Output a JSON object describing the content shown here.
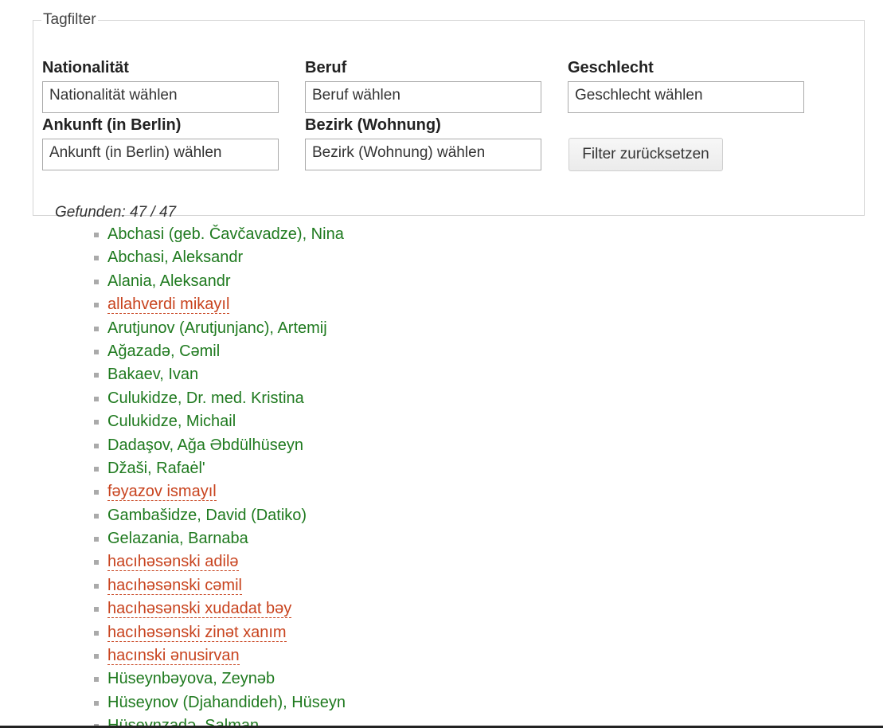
{
  "filter": {
    "legend": "Tagfilter",
    "fields": [
      {
        "label": "Nationalität",
        "placeholder": "Nationalität wählen"
      },
      {
        "label": "Beruf",
        "placeholder": "Beruf wählen"
      },
      {
        "label": "Geschlecht",
        "placeholder": "Geschlecht wählen"
      },
      {
        "label": "Ankunft (in Berlin)",
        "placeholder": "Ankunft (in Berlin) wählen"
      },
      {
        "label": "Bezirk (Wohnung)",
        "placeholder": "Bezirk (Wohnung) wählen"
      }
    ],
    "reset_label": "Filter zurücksetzen",
    "found_text": "Gefunden: 47 / 47"
  },
  "colors": {
    "existing_link": "#1f7a1f",
    "missing_link": "#c8431e"
  },
  "people": [
    {
      "name": "Abchasi (geb. Čavčavadze), Nina",
      "missing": false
    },
    {
      "name": "Abchasi, Aleksandr",
      "missing": false
    },
    {
      "name": "Alania, Aleksandr",
      "missing": false
    },
    {
      "name": "allahverdi mikayıl",
      "missing": true
    },
    {
      "name": "Arutjunov (Arutjunjanc), Artemij",
      "missing": false
    },
    {
      "name": "Ağazadə, Cəmil",
      "missing": false
    },
    {
      "name": "Bakaev, Ivan",
      "missing": false
    },
    {
      "name": "Culukidze, Dr. med. Kristina",
      "missing": false
    },
    {
      "name": "Culukidze, Michail",
      "missing": false
    },
    {
      "name": "Dadaşov, Ağa Əbdülhüseyn",
      "missing": false
    },
    {
      "name": "Džaši, Rafaėl'",
      "missing": false
    },
    {
      "name": "fəyazov ismayıl",
      "missing": true
    },
    {
      "name": "Gambašidze, David (Datiko)",
      "missing": false
    },
    {
      "name": "Gelazania, Barnaba",
      "missing": false
    },
    {
      "name": "hacıhəsənski adilə",
      "missing": true
    },
    {
      "name": "hacıhəsənski cəmil",
      "missing": true
    },
    {
      "name": "hacıhəsənski xudadat bəy",
      "missing": true
    },
    {
      "name": "hacıhəsənski zinət xanım",
      "missing": true
    },
    {
      "name": "hacınski ənusirvan",
      "missing": true
    },
    {
      "name": "Hüseynbəyova, Zeynəb",
      "missing": false
    },
    {
      "name": "Hüseynov (Djahandideh), Hüseyn",
      "missing": false
    },
    {
      "name": "Hüseynzadə, Salman",
      "missing": false
    }
  ]
}
